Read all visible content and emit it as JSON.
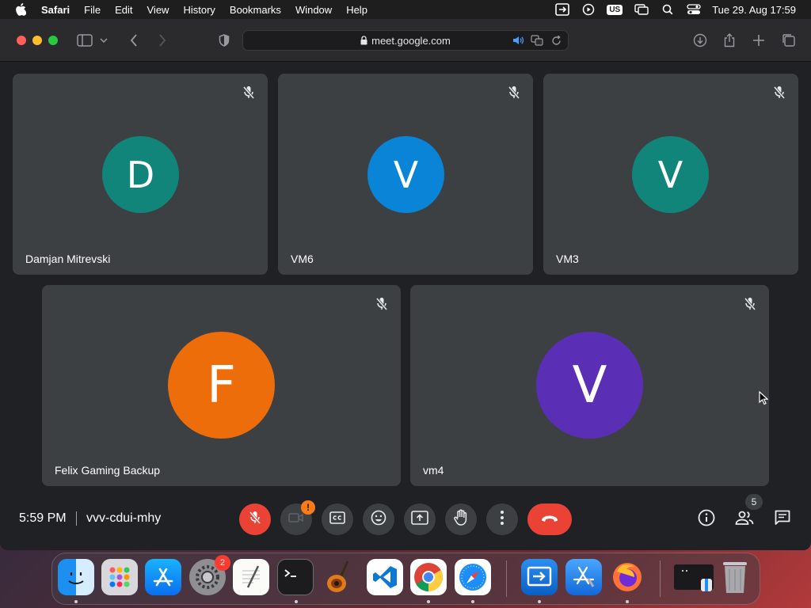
{
  "menubar": {
    "app_name": "Safari",
    "items": [
      "File",
      "Edit",
      "View",
      "History",
      "Bookmarks",
      "Window",
      "Help"
    ],
    "keyboard_layout": "US",
    "clock": "Tue 29. Aug  17:59"
  },
  "browser": {
    "url": "meet.google.com"
  },
  "meet": {
    "participants": [
      {
        "name": "Damjan Mitrevski",
        "initial": "D",
        "color": "#12857a",
        "muted": true
      },
      {
        "name": "VM6",
        "initial": "V",
        "color": "#0a84d6",
        "muted": true
      },
      {
        "name": "VM3",
        "initial": "V",
        "color": "#12857a",
        "muted": true
      },
      {
        "name": "Felix Gaming Backup",
        "initial": "F",
        "color": "#ee6d0b",
        "muted": true
      },
      {
        "name": "vm4",
        "initial": "V",
        "color": "#5b2fb5",
        "muted": true
      }
    ],
    "time": "5:59 PM",
    "meeting_code": "vvv-cdui-mhy",
    "camera_warning": "!",
    "participant_count": "5"
  },
  "dock": {
    "apps": [
      "finder-icon",
      "launchpad-icon",
      "app-store-icon",
      "system-settings-icon",
      "textedit-icon",
      "terminal-icon",
      "garageband-icon",
      "vscode-icon",
      "chrome-icon",
      "safari-icon",
      "remote-desktop-icon",
      "xcode-icon",
      "firefox-icon",
      "window-preview-icon",
      "trash-icon"
    ],
    "settings_badge": "2"
  }
}
